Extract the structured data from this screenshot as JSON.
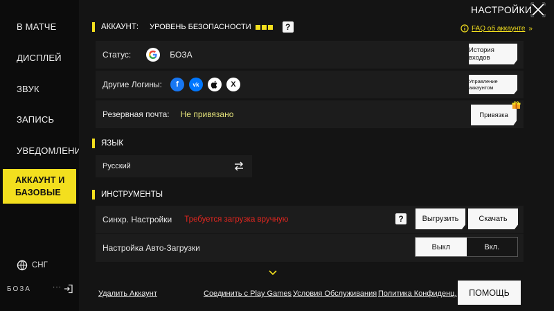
{
  "colors": {
    "accent": "#f3df1e",
    "warning": "#e0261f",
    "muted_yellow": "#e4e27a",
    "bg": "#141414"
  },
  "sidebar": {
    "items": [
      {
        "label": "В МАТЧЕ"
      },
      {
        "label": "ДИСПЛЕЙ"
      },
      {
        "label": "ЗВУК"
      },
      {
        "label": "ЗАПИСЬ"
      },
      {
        "label": "УВЕДОМЛЕНИЕ"
      }
    ],
    "active_item": {
      "line1": "АККАУНТ И",
      "line2": "БАЗОВЫЕ"
    },
    "region": "СНГ",
    "username": "БОЗА",
    "more": "···"
  },
  "header": {
    "title": "НАСТРОЙКИ",
    "close_icon": "close-icon"
  },
  "account": {
    "section_title": "АККАУНТ:",
    "security_label": "УРОВЕНЬ БЕЗОПАСНОСТИ",
    "security_level": 3,
    "help": "?",
    "faq_link": "FAQ об аккаунте",
    "faq_chevron": "»",
    "status_label": "Статус:",
    "status_value": "БОЗА",
    "history_button": "История входов",
    "other_logins_label": "Другие Логины:",
    "social": {
      "fb": "f",
      "vk": "vk",
      "apple": "",
      "x": "X"
    },
    "manage_button": "Управление аккаунтом",
    "backup_email_label": "Резервная почта:",
    "backup_email_value": "Не привязано",
    "bind_button": "Привязка"
  },
  "language": {
    "section_title": "ЯЗЫК",
    "value": "Русский"
  },
  "tools": {
    "section_title": "ИНСТРУМЕНТЫ",
    "sync_label": "Синхр. Настройки",
    "sync_status": "Требуется загрузка вручную",
    "help": "?",
    "upload_button": "Выгрузить",
    "download_button": "Скачать",
    "autoload_label": "Настройка Авто-Загрузки",
    "toggle_off": "Выкл",
    "toggle_on": "Вкл.",
    "selected": "Выкл"
  },
  "footer": {
    "delete_account": "Удалить Аккаунт",
    "connect_play": "Соединить с Play Games",
    "terms": "Условия Обслуживания",
    "policy": "Политика Конфиденц.",
    "help_button": "ПОМОЩЬ"
  }
}
